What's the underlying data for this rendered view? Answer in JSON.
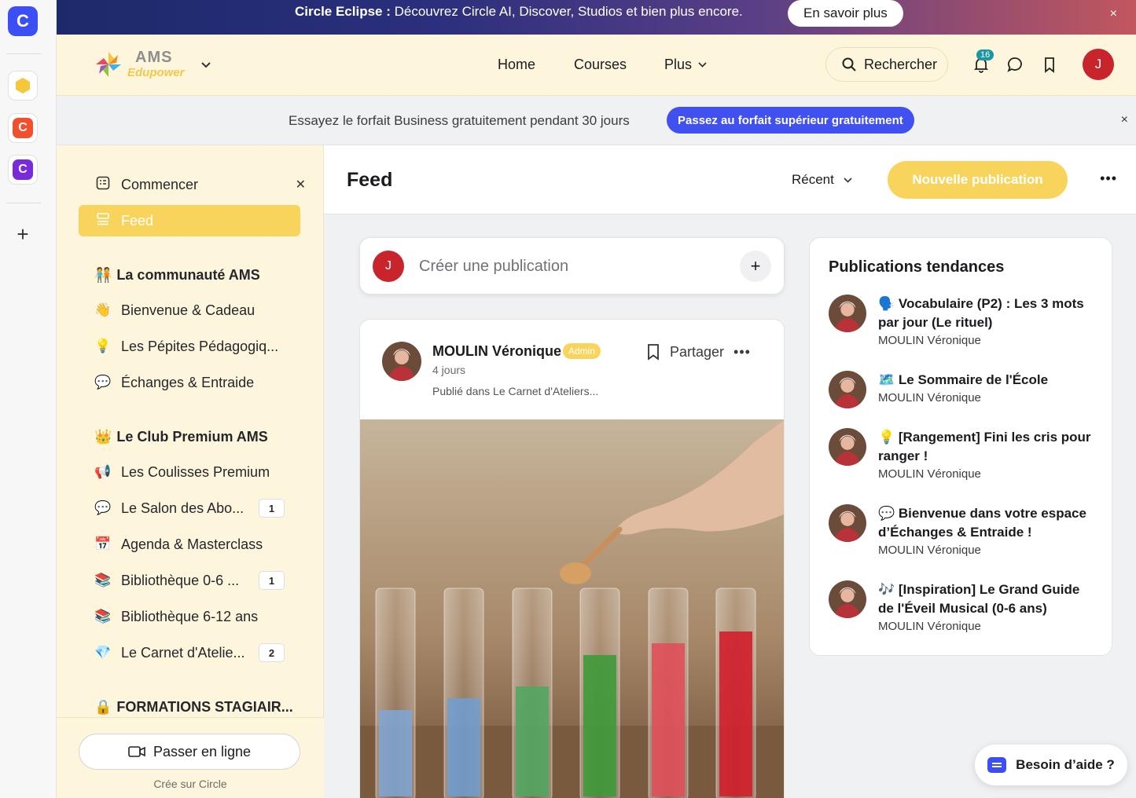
{
  "rail": {
    "logo_letter": "C",
    "apps": [
      {
        "name": "hexagon-app",
        "color": "#f6c73c"
      },
      {
        "name": "orange-c-app",
        "color": "#f0502e",
        "letter": "C"
      },
      {
        "name": "purple-c-app",
        "color": "#7a2bd9",
        "letter": "C"
      }
    ],
    "add_label": "+"
  },
  "announcement": {
    "brand": "Circle Eclipse :",
    "text": " Découvrez Circle AI, Discover, Studios et bien plus encore.",
    "cta": "En savoir plus",
    "close": "×"
  },
  "header": {
    "brand_line1": "AMS",
    "brand_line2": "Edupower",
    "nav": [
      "Home",
      "Courses",
      "Plus"
    ],
    "search_label": "Rechercher",
    "notifications_count": "16",
    "user_initial": "J"
  },
  "promo": {
    "text": "Essayez le forfait Business gratuitement pendant 30 jours",
    "button": "Passez au forfait supérieur gratuitement",
    "close": "×"
  },
  "sidebar": {
    "start_label": "Commencer",
    "feed_label": "Feed",
    "section1": {
      "emoji": "🧑‍🤝‍🧑",
      "title": "La communauté AMS"
    },
    "section1_items": [
      {
        "emoji": "👋",
        "label": "Bienvenue & Cadeau"
      },
      {
        "emoji": "💡",
        "label": "Les Pépites Pédagogiq..."
      },
      {
        "emoji": "💬",
        "label": "Échanges & Entraide"
      }
    ],
    "section2": {
      "emoji": "👑",
      "title": "Le Club Premium AMS"
    },
    "section2_items": [
      {
        "emoji": "📢",
        "label": "Les Coulisses Premium",
        "count": ""
      },
      {
        "emoji": "💬",
        "label": "Le Salon des Abo...",
        "count": "1"
      },
      {
        "emoji": "📅",
        "label": "Agenda & Masterclass",
        "count": ""
      },
      {
        "emoji": "📚",
        "label": "Bibliothèque 0-6 ...",
        "count": "1"
      },
      {
        "emoji": "📚",
        "label": "Bibliothèque 6-12 ans",
        "count": ""
      },
      {
        "emoji": "💎",
        "label": "Le Carnet d'Atelie...",
        "count": "2"
      }
    ],
    "section3": {
      "emoji": "🔒",
      "title": "FORMATIONS STAGIAIR..."
    },
    "live_button": "Passer en ligne",
    "footer_note": "Crée sur Circle"
  },
  "main": {
    "title": "Feed",
    "sort_label": "Récent",
    "new_post": "Nouvelle publication",
    "composer_placeholder": "Créer une publication",
    "composer_avatar": "J"
  },
  "post": {
    "author": "MOULIN Véronique",
    "badge": "Admin",
    "age": "4 jours",
    "space": "Publié dans Le Carnet d'Ateliers...",
    "share": "Partager"
  },
  "trending": {
    "title": "Publications tendances",
    "items": [
      {
        "title": "🗣️ Vocabulaire (P2) : Les 3 mots par jour (Le rituel)",
        "author": "MOULIN Véronique"
      },
      {
        "title": "🗺️ Le Sommaire de l'École",
        "author": "MOULIN Véronique"
      },
      {
        "title": "💡 [Rangement] Fini les cris pour ranger !",
        "author": "MOULIN Véronique"
      },
      {
        "title": "💬 Bienvenue dans votre espace d’Échanges & Entraide !",
        "author": "MOULIN Véronique"
      },
      {
        "title": "🎶 [Inspiration] Le Grand Guide de l'Éveil Musical (0-6 ans)",
        "author": "MOULIN Véronique"
      }
    ]
  },
  "help": {
    "label": "Besoin d’aide ?"
  },
  "colors": {
    "accent_yellow": "#f9d45c",
    "cream": "#fef6dc",
    "blue": "#4051f0",
    "red": "#c8242c"
  }
}
